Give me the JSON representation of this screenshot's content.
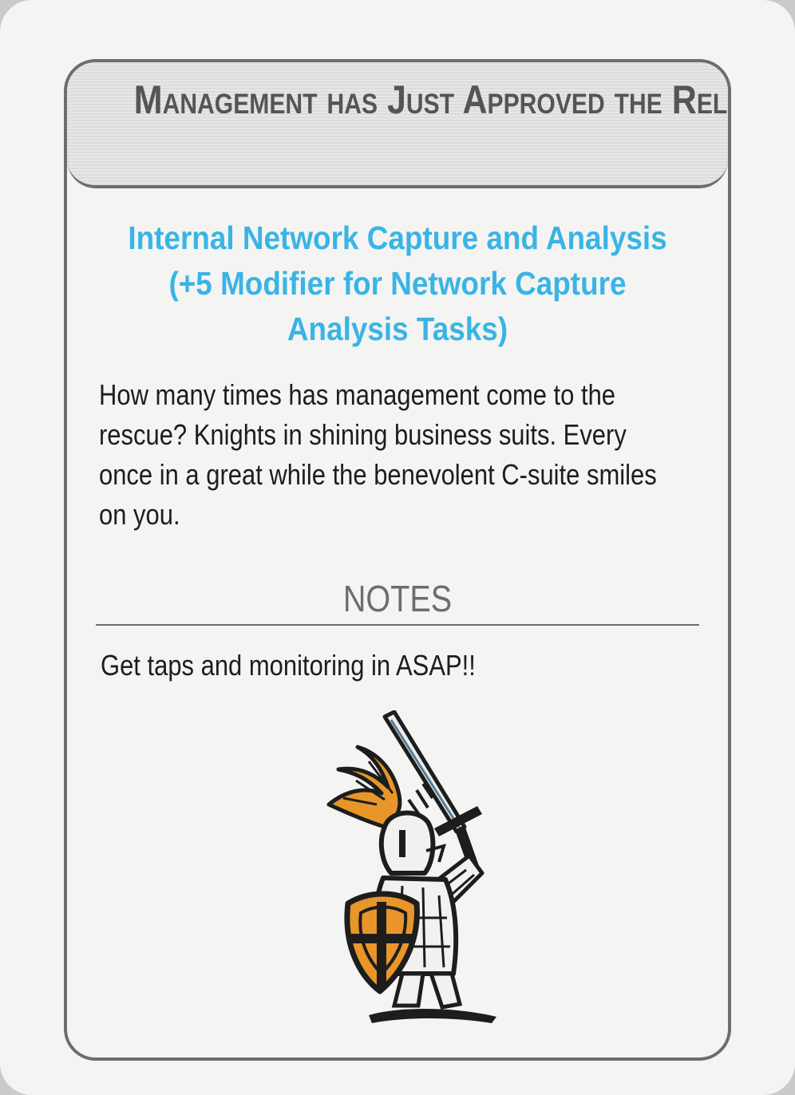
{
  "card": {
    "title": "Management has Just Approved the Release of a New Procedure",
    "procedure": "Internal Network Capture and Analysis (+5 Modifier for Network Capture Analysis Tasks)",
    "flavor_text": "How many times has management come to the rescue? Knights in shining business suits. Every once in a great while the benevolent C-suite smiles on you.",
    "notes_label": "NOTES",
    "note": "Get taps and monitoring in ASAP!!",
    "illustration": "knight-with-sword-and-shield-icon"
  },
  "colors": {
    "header_text": "#555555",
    "procedure_text": "#39b4e6",
    "body_text": "#1d1d1d",
    "frame": "#6d6d6d",
    "shield_orange": "#e8962a",
    "plume_orange": "#e8962a"
  }
}
